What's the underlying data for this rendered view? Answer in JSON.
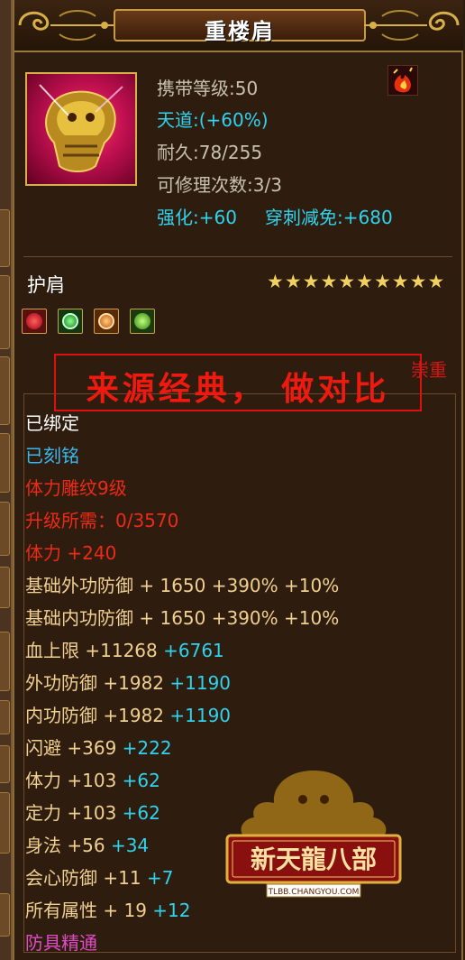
{
  "item": {
    "name": "重楼肩",
    "carry_level": "携带等级:50",
    "tiandao": "天道:(+60%)",
    "durability": "耐久:78/255",
    "repair_count": "可修理次数:3/3",
    "enhance": "强化:+60",
    "pierce_reduction": "穿刺减免:+680",
    "type": "护肩",
    "stars": 10,
    "colors": {
      "cyan": "#2fd3ee",
      "red": "#ee2a16",
      "gold": "#f0d090",
      "border": "#d8b048"
    }
  },
  "gems": [
    "red-gem-icon",
    "green-gem-icon",
    "orange-gem-icon",
    "jade-gem-icon"
  ],
  "watermark": {
    "text": "来源经典，  做对比",
    "side_label": "崇重"
  },
  "stats": [
    {
      "label": "已绑定",
      "color": "white"
    },
    {
      "label": "已刻铭",
      "color": "blue"
    },
    {
      "label": "体力雕纹9级",
      "color": "red"
    },
    {
      "label": "升级所需：0/3570",
      "color": "red"
    },
    {
      "label": "体力 +240",
      "color": "red"
    },
    {
      "label": "基础外功防御 + 1650 +390% +10%",
      "color": "gold"
    },
    {
      "label": "基础内功防御 + 1650 +390% +10%",
      "color": "gold"
    },
    {
      "label": "血上限 +11268",
      "extra": "+6761",
      "color": "gold"
    },
    {
      "label": "外功防御 +1982",
      "extra": "+1190",
      "color": "gold"
    },
    {
      "label": "内功防御 +1982",
      "extra": "+1190",
      "color": "gold"
    },
    {
      "label": "闪避 +369",
      "extra": "+222",
      "color": "gold"
    },
    {
      "label": "体力 +103",
      "extra": "+62",
      "color": "gold"
    },
    {
      "label": "定力 +103",
      "extra": "+62",
      "color": "gold"
    },
    {
      "label": "身法 +56",
      "extra": "+34",
      "color": "gold"
    },
    {
      "label": "会心防御 +11",
      "extra": "+7",
      "color": "gold"
    },
    {
      "label": "所有属性 + 19",
      "extra": "+12",
      "color": "gold"
    },
    {
      "label": "防具精通",
      "color": "pink"
    }
  ],
  "logo": {
    "brand": "新天龍八部",
    "url_text": "TLBB.CHANGYOU.COM"
  }
}
